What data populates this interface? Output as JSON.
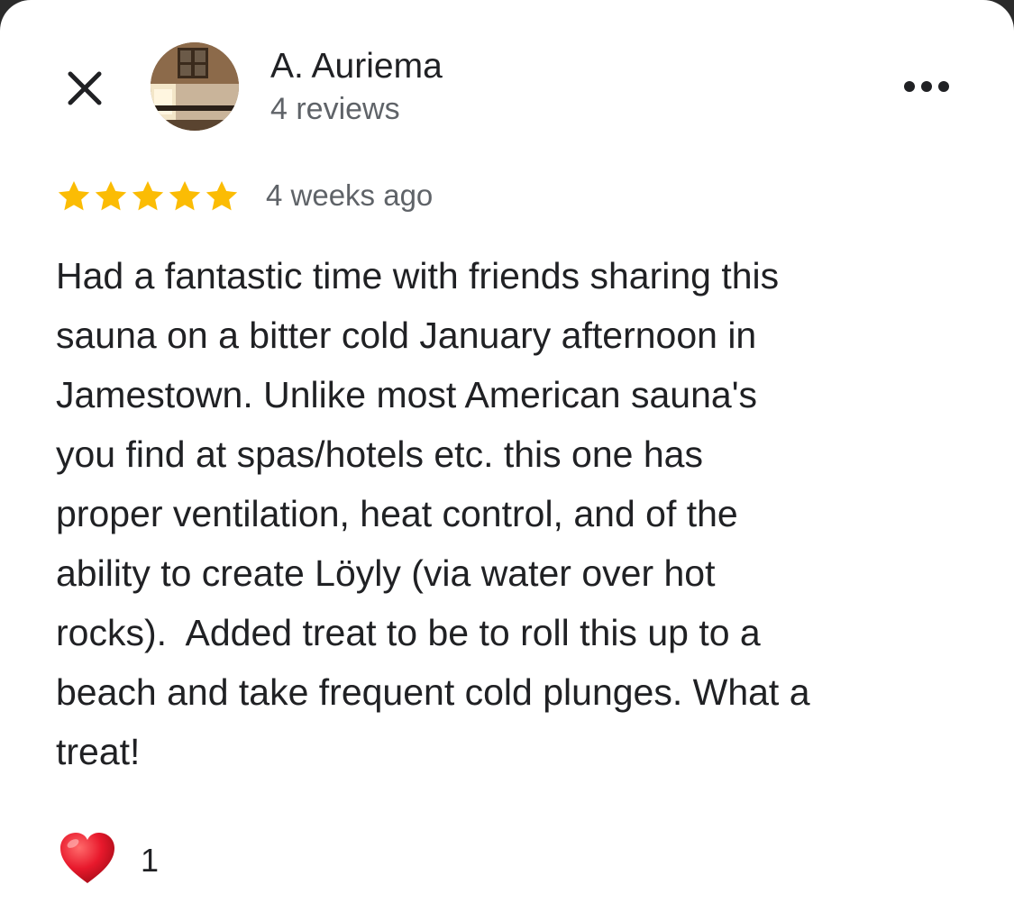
{
  "reviewer": {
    "name": "A. Auriema",
    "review_count": "4 reviews"
  },
  "review": {
    "rating": 5,
    "max_rating": 5,
    "date": "4 weeks ago",
    "text": "Had a fantastic time with friends sharing this\nsauna on a bitter cold January afternoon in\nJamestown. Unlike most American sauna's\nyou find at spas/hotels etc. this one has\nproper ventilation, heat control, and of the\nability to create Löyly (via water over hot\nrocks).  Added treat to be to roll this up to a\nbeach and take frequent cold plunges. What a\ntreat!"
  },
  "reactions": {
    "heart_count": "1"
  },
  "icons": {
    "close": "close-icon",
    "more": "more-horizontal-icon",
    "star": "star-icon",
    "heart": "heart-icon"
  },
  "colors": {
    "star": "#fbbc04",
    "heart": "#e8192c",
    "text_primary": "#202124",
    "text_secondary": "#5f6368"
  }
}
